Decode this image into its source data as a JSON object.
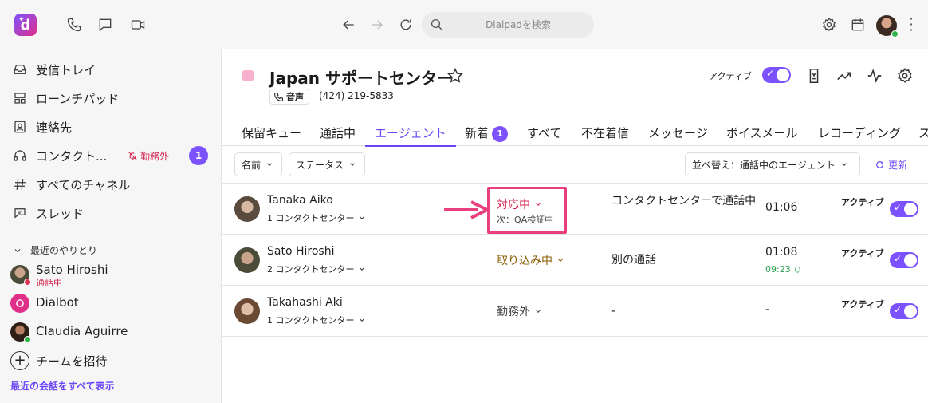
{
  "topbar": {
    "search_placeholder": "Dialpadを検索"
  },
  "sidebar": {
    "items": [
      {
        "label": "受信トレイ",
        "icon": "inbox-icon"
      },
      {
        "label": "ローンチパッド",
        "icon": "launchpad-icon"
      },
      {
        "label": "連絡先",
        "icon": "contacts-icon"
      },
      {
        "label": "コンタクト...",
        "icon": "headset-icon",
        "status": "勤務外",
        "badge": "1"
      },
      {
        "label": "すべてのチャネル",
        "icon": "hash-icon"
      },
      {
        "label": "スレッド",
        "icon": "threads-icon"
      }
    ],
    "recent_header": "最近のやりとり",
    "recent": [
      {
        "name": "Sato Hiroshi",
        "sub": "通話中"
      },
      {
        "name": "Dialbot",
        "sub": ""
      },
      {
        "name": "Claudia Aguirre",
        "sub": ""
      }
    ],
    "invite_label": "チームを招待",
    "show_all": "最近の会話をすべて表示"
  },
  "main": {
    "title": "Japan サポートセンター",
    "voice_label": "音声",
    "phone": "(424) 219-5833",
    "active_label": "アクティブ",
    "tabs": [
      {
        "label": "保留キュー"
      },
      {
        "label": "通話中"
      },
      {
        "label": "エージェント"
      },
      {
        "label": "新着",
        "badge": "1"
      },
      {
        "label": "すべて"
      },
      {
        "label": "不在着信"
      },
      {
        "label": "メッセージ"
      },
      {
        "label": "ボイスメール"
      },
      {
        "label": "レコーディング"
      },
      {
        "label": "ス"
      }
    ],
    "filters": {
      "name": "名前",
      "status": "ステータス",
      "sort": "並べ替え：通話中のエージェント",
      "refresh": "更新"
    },
    "agents": [
      {
        "name": "Tanaka Aiko",
        "cc": "1 コンタクトセンター",
        "status": "対応中",
        "next": "次：QA検証中",
        "info": "コンタクトセンターで通話中",
        "time": "01:06",
        "subtime": "",
        "active": "アクティブ"
      },
      {
        "name": "Sato Hiroshi",
        "cc": "2 コンタクトセンター",
        "status": "取り込み中",
        "next": "",
        "info": "別の通話",
        "time": "01:08",
        "subtime": "09:23",
        "active": "アクティブ"
      },
      {
        "name": "Takahashi Aki",
        "cc": "1 コンタクトセンター",
        "status": "勤務外",
        "next": "",
        "info": "-",
        "time": "-",
        "subtime": "",
        "active": "アクティブ"
      }
    ]
  },
  "colors": {
    "accent": "#7c52ff",
    "busy_red": "#d6264f",
    "dnd_brown": "#8a5a00",
    "highlight": "#ea3f7e",
    "online_green": "#32b24a"
  }
}
